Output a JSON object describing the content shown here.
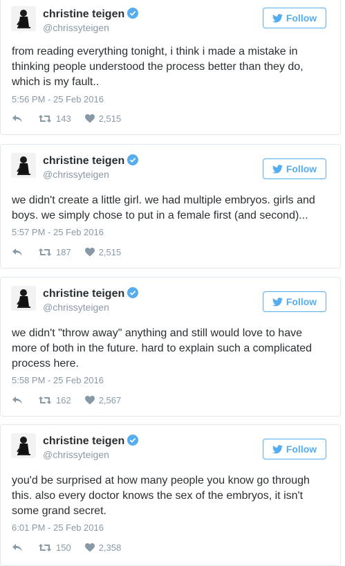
{
  "tweets": [
    {
      "name": "christine teigen",
      "handle": "@chrissyteigen",
      "follow_label": "Follow",
      "text": "from reading everything tonight, i think i made a mistake in thinking people understood the process better than they do, which is my fault..",
      "timestamp": "5:56 PM - 25 Feb 2016",
      "retweets": "143",
      "likes": "2,515"
    },
    {
      "name": "christine teigen",
      "handle": "@chrissyteigen",
      "follow_label": "Follow",
      "text": "we didn't create a little girl. we had multiple embryos. girls and boys. we simply chose to put in a female first (and second)...",
      "timestamp": "5:57 PM - 25 Feb 2016",
      "retweets": "187",
      "likes": "2,515"
    },
    {
      "name": "christine teigen",
      "handle": "@chrissyteigen",
      "follow_label": "Follow",
      "text": "we didn't \"throw away\" anything and still would love to have more of both in the future. hard to explain such a complicated process here.",
      "timestamp": "5:58 PM - 25 Feb 2016",
      "retweets": "162",
      "likes": "2,567"
    },
    {
      "name": "christine teigen",
      "handle": "@chrissyteigen",
      "follow_label": "Follow",
      "text": "you'd be surprised at how many people you know go through this. also every doctor knows the sex of the embryos, it isn't some grand secret.",
      "timestamp": "6:01 PM - 25 Feb 2016",
      "retweets": "150",
      "likes": "2,358"
    }
  ],
  "colors": {
    "accent": "#55acee",
    "text": "#292f33",
    "muted": "#8899a6",
    "border": "#e1e8ed"
  },
  "icons": [
    "avatar-photo",
    "verified-badge-icon",
    "twitter-bird-icon",
    "reply-icon",
    "retweet-icon",
    "heart-icon"
  ]
}
